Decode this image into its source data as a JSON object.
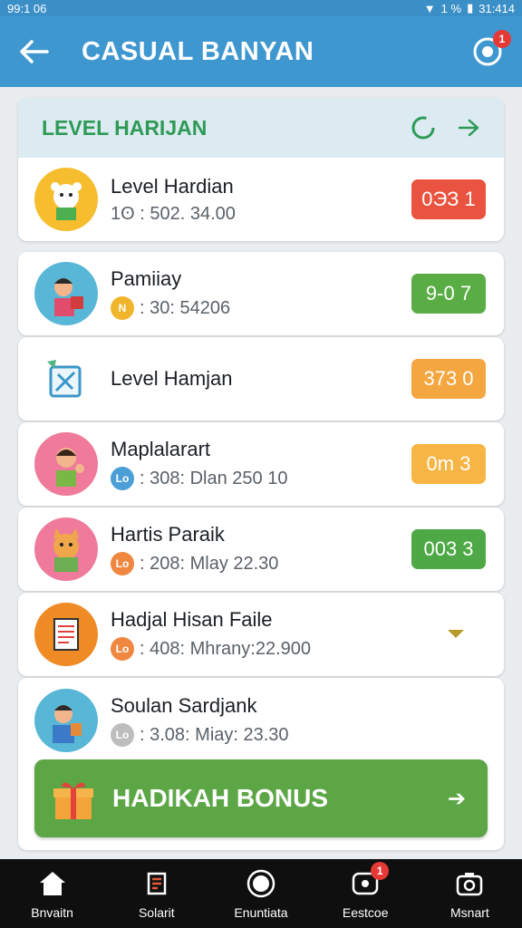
{
  "status": {
    "time": "99:1 06",
    "battery": "1 %",
    "clock": "31:414"
  },
  "appbar": {
    "title": "CASUAL BANYAN",
    "notif_count": "1"
  },
  "header": {
    "title": "LEVEL HARIJAN"
  },
  "rows": [
    {
      "name": "Level Hardian",
      "coin": "1",
      "sub": "1ʘ : 502. 34.00",
      "score": "0ЭЗ 1",
      "score_color": "#e9533f"
    },
    {
      "name": "Pamiiay",
      "coin": "N",
      "sub": ": 30: 54206",
      "score": "9-0 7",
      "score_color": "#5aac45"
    },
    {
      "name": "Level Hamjan",
      "coin": "",
      "sub": "",
      "score": "373 0",
      "score_color": "#f4a640"
    },
    {
      "name": "Maplalarart",
      "coin": "Lo",
      "sub": ": 308: Dlan 250 10",
      "score": "0m 3",
      "score_color": "#f6b545"
    },
    {
      "name": "Hartis Paraik",
      "coin": "Lo",
      "sub": ": 208: Mlay 22.30",
      "score": "003 3",
      "score_color": "#4fa846"
    },
    {
      "name": "Hadjal Hisan Faile",
      "coin": "Lo",
      "sub": ": 408: Mhrany:22.900",
      "score": "",
      "score_color": ""
    },
    {
      "name": "Soulan Sardjank",
      "coin": "Lo",
      "sub": ": 3.08: Miay: 23.30",
      "score": "",
      "score_color": ""
    }
  ],
  "bonus": {
    "label": "HADIKAH BONUS"
  },
  "nav": [
    {
      "label": "Bnvaitn"
    },
    {
      "label": "Solarit"
    },
    {
      "label": "Enuntiata"
    },
    {
      "label": "Eestcoe",
      "badge": "1"
    },
    {
      "label": "Msnart"
    }
  ]
}
